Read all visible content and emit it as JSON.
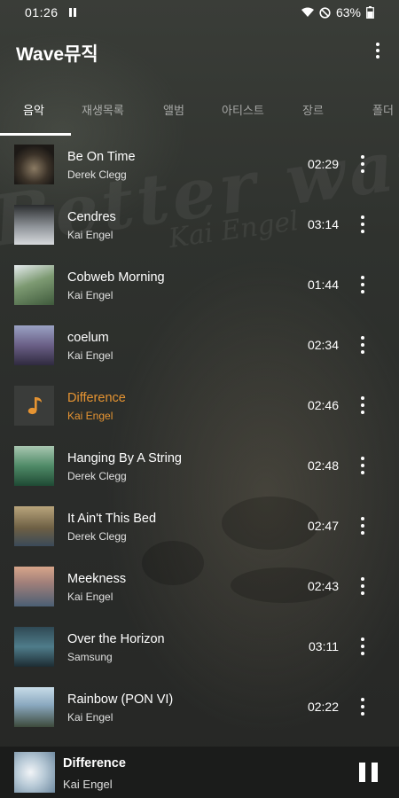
{
  "status": {
    "time": "01:26",
    "battery": "63%"
  },
  "app": {
    "title": "Wave뮤직"
  },
  "tabs": [
    "음악",
    "재생목록",
    "앨범",
    "아티스트",
    "장르",
    "폴더"
  ],
  "songs": [
    {
      "title": "Be On Time",
      "artist": "Derek Clegg",
      "duration": "02:29"
    },
    {
      "title": "Cendres",
      "artist": "Kai Engel",
      "duration": "03:14"
    },
    {
      "title": "Cobweb Morning",
      "artist": "Kai Engel",
      "duration": "01:44"
    },
    {
      "title": "coelum",
      "artist": "Kai Engel",
      "duration": "02:34"
    },
    {
      "title": "Difference",
      "artist": "Kai Engel",
      "duration": "02:46"
    },
    {
      "title": "Hanging By A String",
      "artist": "Derek Clegg",
      "duration": "02:48"
    },
    {
      "title": "It Ain't This Bed",
      "artist": "Derek Clegg",
      "duration": "02:47"
    },
    {
      "title": "Meekness",
      "artist": "Kai Engel",
      "duration": "02:43"
    },
    {
      "title": "Over the Horizon",
      "artist": "Samsung",
      "duration": "03:11"
    },
    {
      "title": "Rainbow (PON VI)",
      "artist": "Kai Engel",
      "duration": "02:22"
    }
  ],
  "now_playing": {
    "title": "Difference",
    "artist": "Kai Engel"
  },
  "colors": {
    "accent": "#e69432",
    "background": "#2f322e",
    "mini_player": "#1b1c1b"
  }
}
